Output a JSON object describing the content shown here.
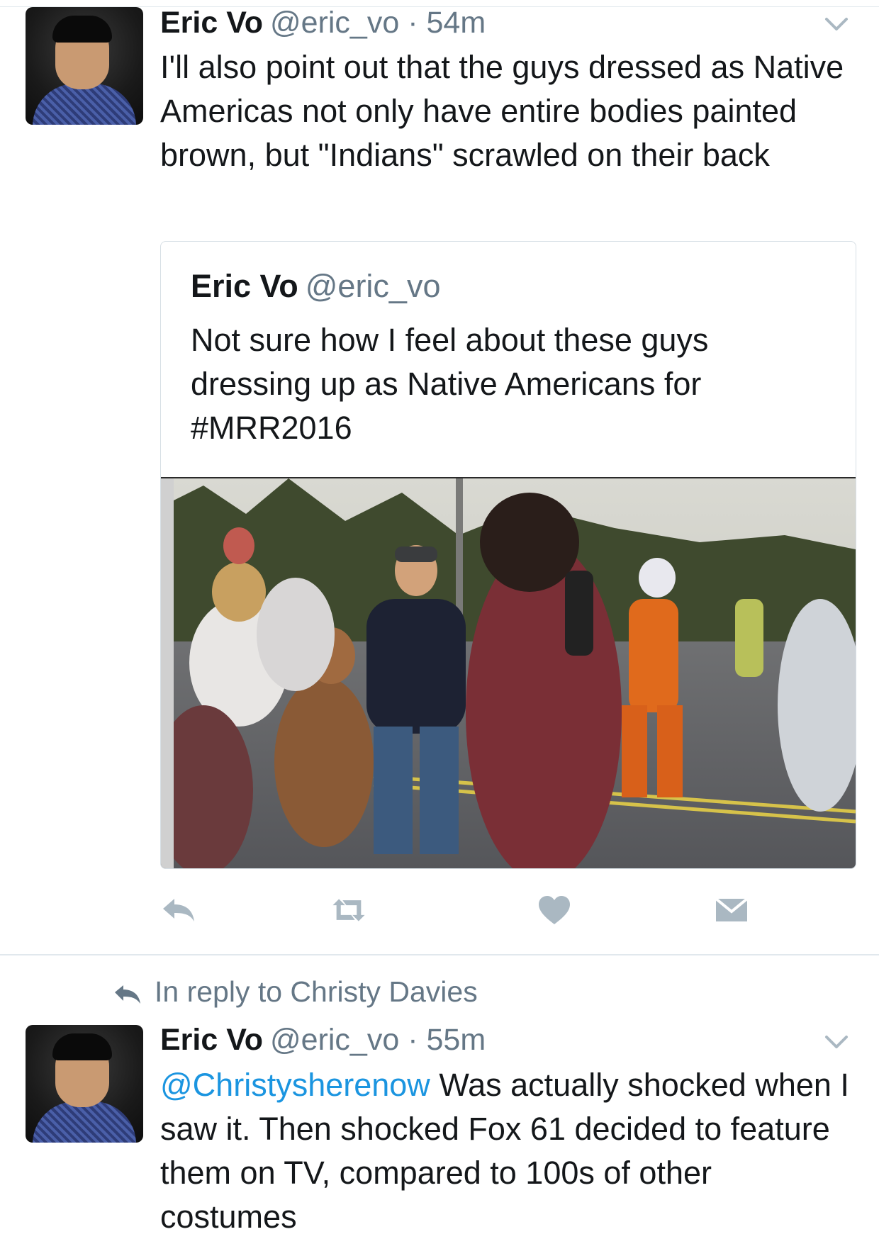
{
  "tweets": [
    {
      "name": "Eric Vo",
      "handle": "@eric_vo",
      "time": "· 54m",
      "text": "I'll also point out that the guys dressed as Native Americas not only have entire bodies painted brown, but \"Indians\" scrawled on their back",
      "quoted": {
        "name": "Eric Vo",
        "handle": "@eric_vo",
        "text": "Not sure how I feel about these guys dressing up as Native Americans for #MRR2016",
        "media": "photo of costumed runners and a Fox 61 reporter on a road"
      },
      "actions": [
        "reply-icon",
        "retweet-icon",
        "like-icon",
        "direct-message-icon"
      ]
    },
    {
      "reply_context": "In reply to Christy Davies",
      "name": "Eric Vo",
      "handle": "@eric_vo",
      "time": "· 55m",
      "mention": "@Christysherenow",
      "text": " Was actually shocked when I saw it. Then shocked Fox 61 decided to feature them on TV, compared to 100s of other costumes"
    }
  ],
  "colors": {
    "text": "#14171a",
    "secondary": "#657786",
    "link": "#1b95e0",
    "divider": "#e1e8ed",
    "icon": "#aab8c2"
  }
}
